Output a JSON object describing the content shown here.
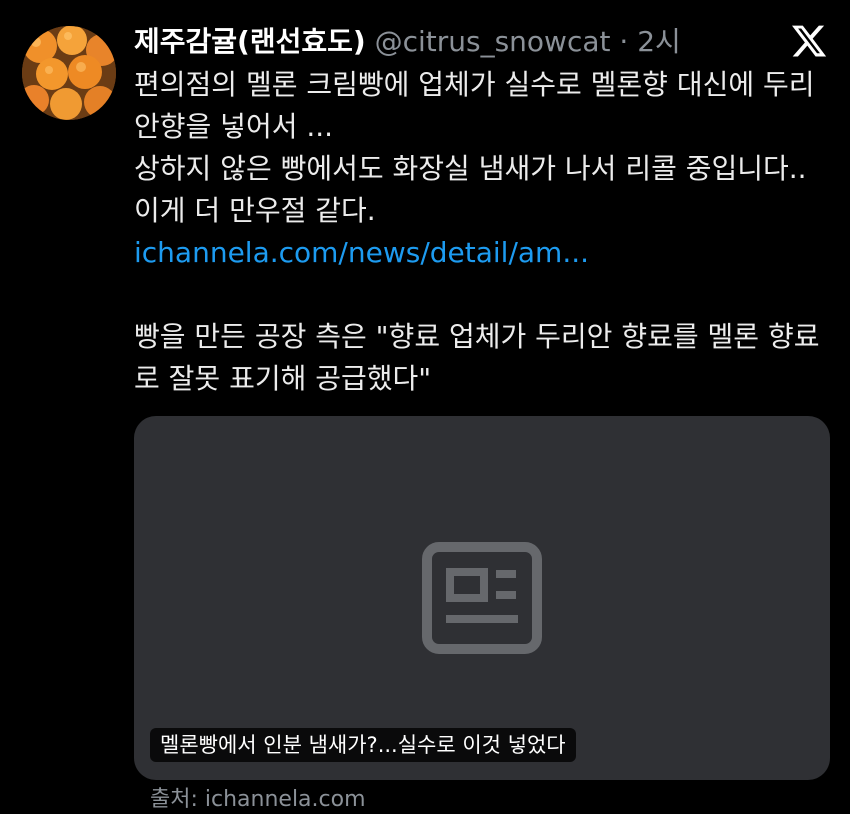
{
  "author": {
    "display_name": "제주감귤(랜선효도)",
    "handle": "@citrus_snowcat",
    "separator": "·",
    "time": "2시",
    "avatar_icon": "oranges-avatar"
  },
  "platform_icon": "x-logo-icon",
  "tweet": {
    "paragraph1": "편의점의 멜론 크림빵에 업체가 실수로 멜론향 대신에 두리안향을 넣어서 ...",
    "paragraph2": "상하지 않은 빵에서도 화장실 냄새가 나서 리콜 중입니다.. 이게 더 만우절 같다.",
    "link": "ichannela.com/news/detail/am...",
    "paragraph3": "빵을 만든 공장 측은 \"향료 업체가 두리안 향료를 멜론 향료로 잘못 표기해 공급했다\""
  },
  "link_card": {
    "icon": "article-icon",
    "title": "멜론빵에서 인분 냄새가?...실수로 이것 넣었다"
  },
  "card_source": "출처: ichannela.com",
  "colors": {
    "background": "#000000",
    "link": "#1d9bf0",
    "muted": "#8b9198",
    "card": "#2f3034"
  }
}
